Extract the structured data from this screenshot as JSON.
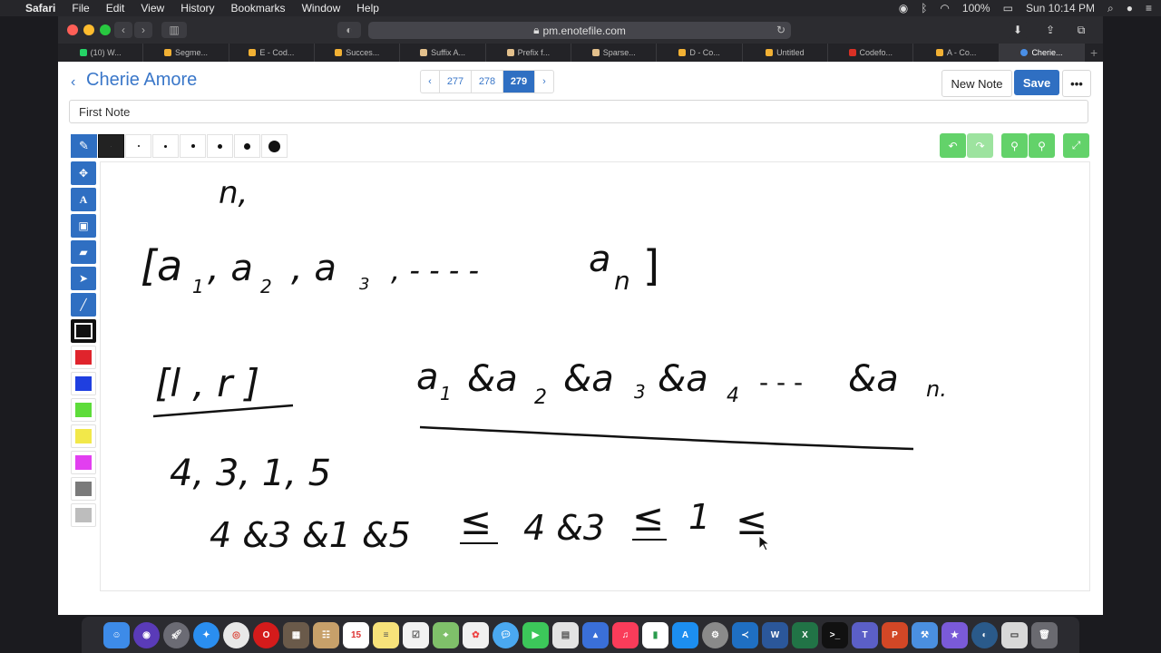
{
  "menubar": {
    "app": "Safari",
    "items": [
      "File",
      "Edit",
      "View",
      "History",
      "Bookmarks",
      "Window",
      "Help"
    ],
    "battery": "100%",
    "clock": "Sun 10:14 PM"
  },
  "browser": {
    "url": "pm.enotefile.com",
    "tabs": [
      {
        "label": "(10) W...",
        "color": "#25d366"
      },
      {
        "label": "Segme...",
        "color": "#f2b134"
      },
      {
        "label": "E - Cod...",
        "color": "#f2b134"
      },
      {
        "label": "Succes...",
        "color": "#f2b134"
      },
      {
        "label": "Suffix A...",
        "color": "#e3c08c"
      },
      {
        "label": "Prefix f...",
        "color": "#e3c08c"
      },
      {
        "label": "Sparse...",
        "color": "#e3c08c"
      },
      {
        "label": "D - Co...",
        "color": "#f2b134"
      },
      {
        "label": "Untitled",
        "color": "#f2b134"
      },
      {
        "label": "Codefo...",
        "color": "#d93025"
      },
      {
        "label": "A - Co...",
        "color": "#f2b134"
      },
      {
        "label": "Cherie...",
        "color": "#4a8fe7"
      }
    ]
  },
  "note": {
    "owner": "Cherie Amore",
    "pages": [
      "‹",
      "277",
      "278",
      "279",
      "›"
    ],
    "current_page": "279",
    "new_note": "New Note",
    "save": "Save",
    "more": "•••",
    "title": "First Note"
  },
  "colors": {
    "accent": "#2f6fc2",
    "green": "#63d26a",
    "palette": [
      "#111111",
      "#e0242c",
      "#1f3fe0",
      "#5ddc3a",
      "#f2e84a",
      "#e23ff0",
      "#7a7a7a",
      "#bdbdbd"
    ]
  },
  "handwriting": {
    "l1": "n,",
    "l2a": "[a",
    "l2b": "1",
    "l2c": ", a",
    "l2d": "2",
    "l2e": ", a",
    "l2f": "3",
    "l2g": ", - - - -",
    "l2h": "a",
    "l2i": "n",
    "l2j": "]",
    "l3a": "[l , r ]",
    "l3b": "a",
    "l3c": "1",
    "l3d": "&a",
    "l3e": "2",
    "l3f": "&a",
    "l3g": "3",
    "l3h": "&a",
    "l3i": "4",
    "l3j": "- - -",
    "l3k": "&a",
    "l3l": "n.",
    "l4": "4, 3, 1, 5",
    "l5a": "4 &3 &1 &5",
    "l5b": "≤",
    "l5c": "4 &3",
    "l5d": "≤",
    "l5e": "1",
    "l5f": "≤"
  }
}
